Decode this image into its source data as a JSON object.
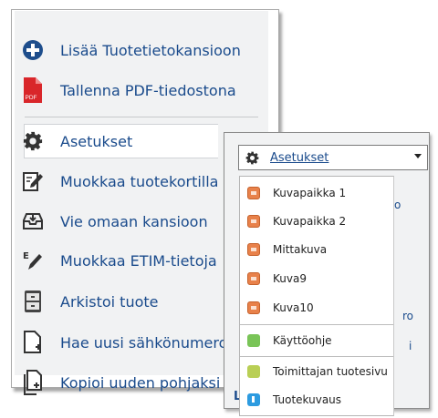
{
  "panel": {
    "items": [
      {
        "label": "Lisää Tuotetietokansioon",
        "icon": "plus-circle-icon"
      },
      {
        "label": "Tallenna PDF-tiedostona",
        "icon": "pdf-icon",
        "badge": "PDF"
      },
      {
        "label": "Asetukset",
        "icon": "gear-icon"
      },
      {
        "label": "Muokkaa tuotekortilla",
        "icon": "edit-document-icon"
      },
      {
        "label": "Vie omaan kansioon",
        "icon": "tray-download-icon"
      },
      {
        "label": "Muokkaa ETIM-tietoja",
        "icon": "edit-pen-icon"
      },
      {
        "label": "Arkistoi tuote",
        "icon": "archive-cabinet-icon"
      },
      {
        "label": "Hae uusi sähkönumero",
        "icon": "new-document-icon"
      },
      {
        "label": "Kopioi uuden pohjaksi",
        "icon": "copy-document-icon"
      }
    ]
  },
  "dropdown": {
    "selected": "Asetukset",
    "options": [
      {
        "label": "Kuvapaikka 1",
        "icon": "image-icon"
      },
      {
        "label": "Kuvapaikka 2",
        "icon": "image-icon"
      },
      {
        "label": "Mittakuva",
        "icon": "image-icon"
      },
      {
        "label": "Kuva9",
        "icon": "image-icon"
      },
      {
        "label": "Kuva10",
        "icon": "image-icon"
      },
      {
        "label": "Käyttöohje",
        "icon": "pencil-icon"
      },
      {
        "label": "Toimittajan tuotesivu",
        "icon": "link-icon"
      },
      {
        "label": "Tuotekuvaus",
        "icon": "info-icon"
      }
    ]
  },
  "background_peek": {
    "li": "Li",
    "ro": "ro",
    "i": "i",
    "o": "o"
  },
  "colors": {
    "link": "#1a4b8c",
    "panel_bg": "#f1f2f3",
    "plus_circle": "#1e4e8c",
    "pdf_red": "#d9262a"
  }
}
